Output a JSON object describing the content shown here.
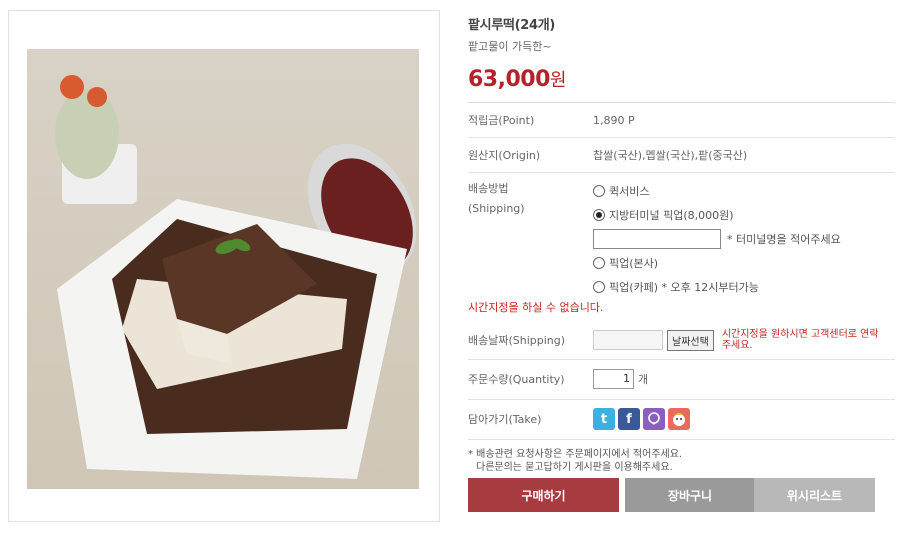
{
  "product": {
    "title": "팥시루떡(24개)",
    "subtitle": "팥고물이 가득한~",
    "price_number": "63,000",
    "price_unit": "원"
  },
  "details": {
    "point_label": "적립금(Point)",
    "point_value": "1,890 P",
    "origin_label": "원산지(Origin)",
    "origin_value": "찹쌀(국산),멥쌀(국산),팥(중국산)",
    "shipping_label_1": "배송방법",
    "shipping_label_2": "(Shipping)",
    "shipping_options": [
      {
        "label": "퀵서비스",
        "selected": false
      },
      {
        "label": "지방터미널 픽업(8,000원)",
        "selected": true
      },
      {
        "label": "픽업(본사)",
        "selected": false
      },
      {
        "label": "픽업(카페) * 오후 12시부터가능",
        "selected": false
      }
    ],
    "terminal_hint": "* 터미널명을 적어주세요",
    "time_warning": "시간지정을 하실 수 없습니다.",
    "date_label": "배송날짜(Shipping)",
    "date_button": "날짜선택",
    "date_note": "시간지정을 원하시면 고객센터로 연락주세요.",
    "qty_label": "주문수량(Quantity)",
    "qty_value": "1",
    "qty_unit": "개",
    "take_label": "담아가기(Take)",
    "notice_line1": "* 배송관련 요청사항은 주문페이지에서 적어주세요.",
    "notice_line2": "다른문의는 묻고답하기 게시판을 이용해주세요."
  },
  "icons": [
    "twitter-icon",
    "facebook-icon",
    "chat-icon",
    "kakao-icon"
  ],
  "buttons": {
    "buy": "구매하기",
    "cart": "장바구니",
    "wishlist": "위시리스트"
  },
  "colors": {
    "price": "#b5232a",
    "buy_button": "#a63c40",
    "cart_button": "#9a9a9a",
    "wish_button": "#b8b8b8"
  }
}
